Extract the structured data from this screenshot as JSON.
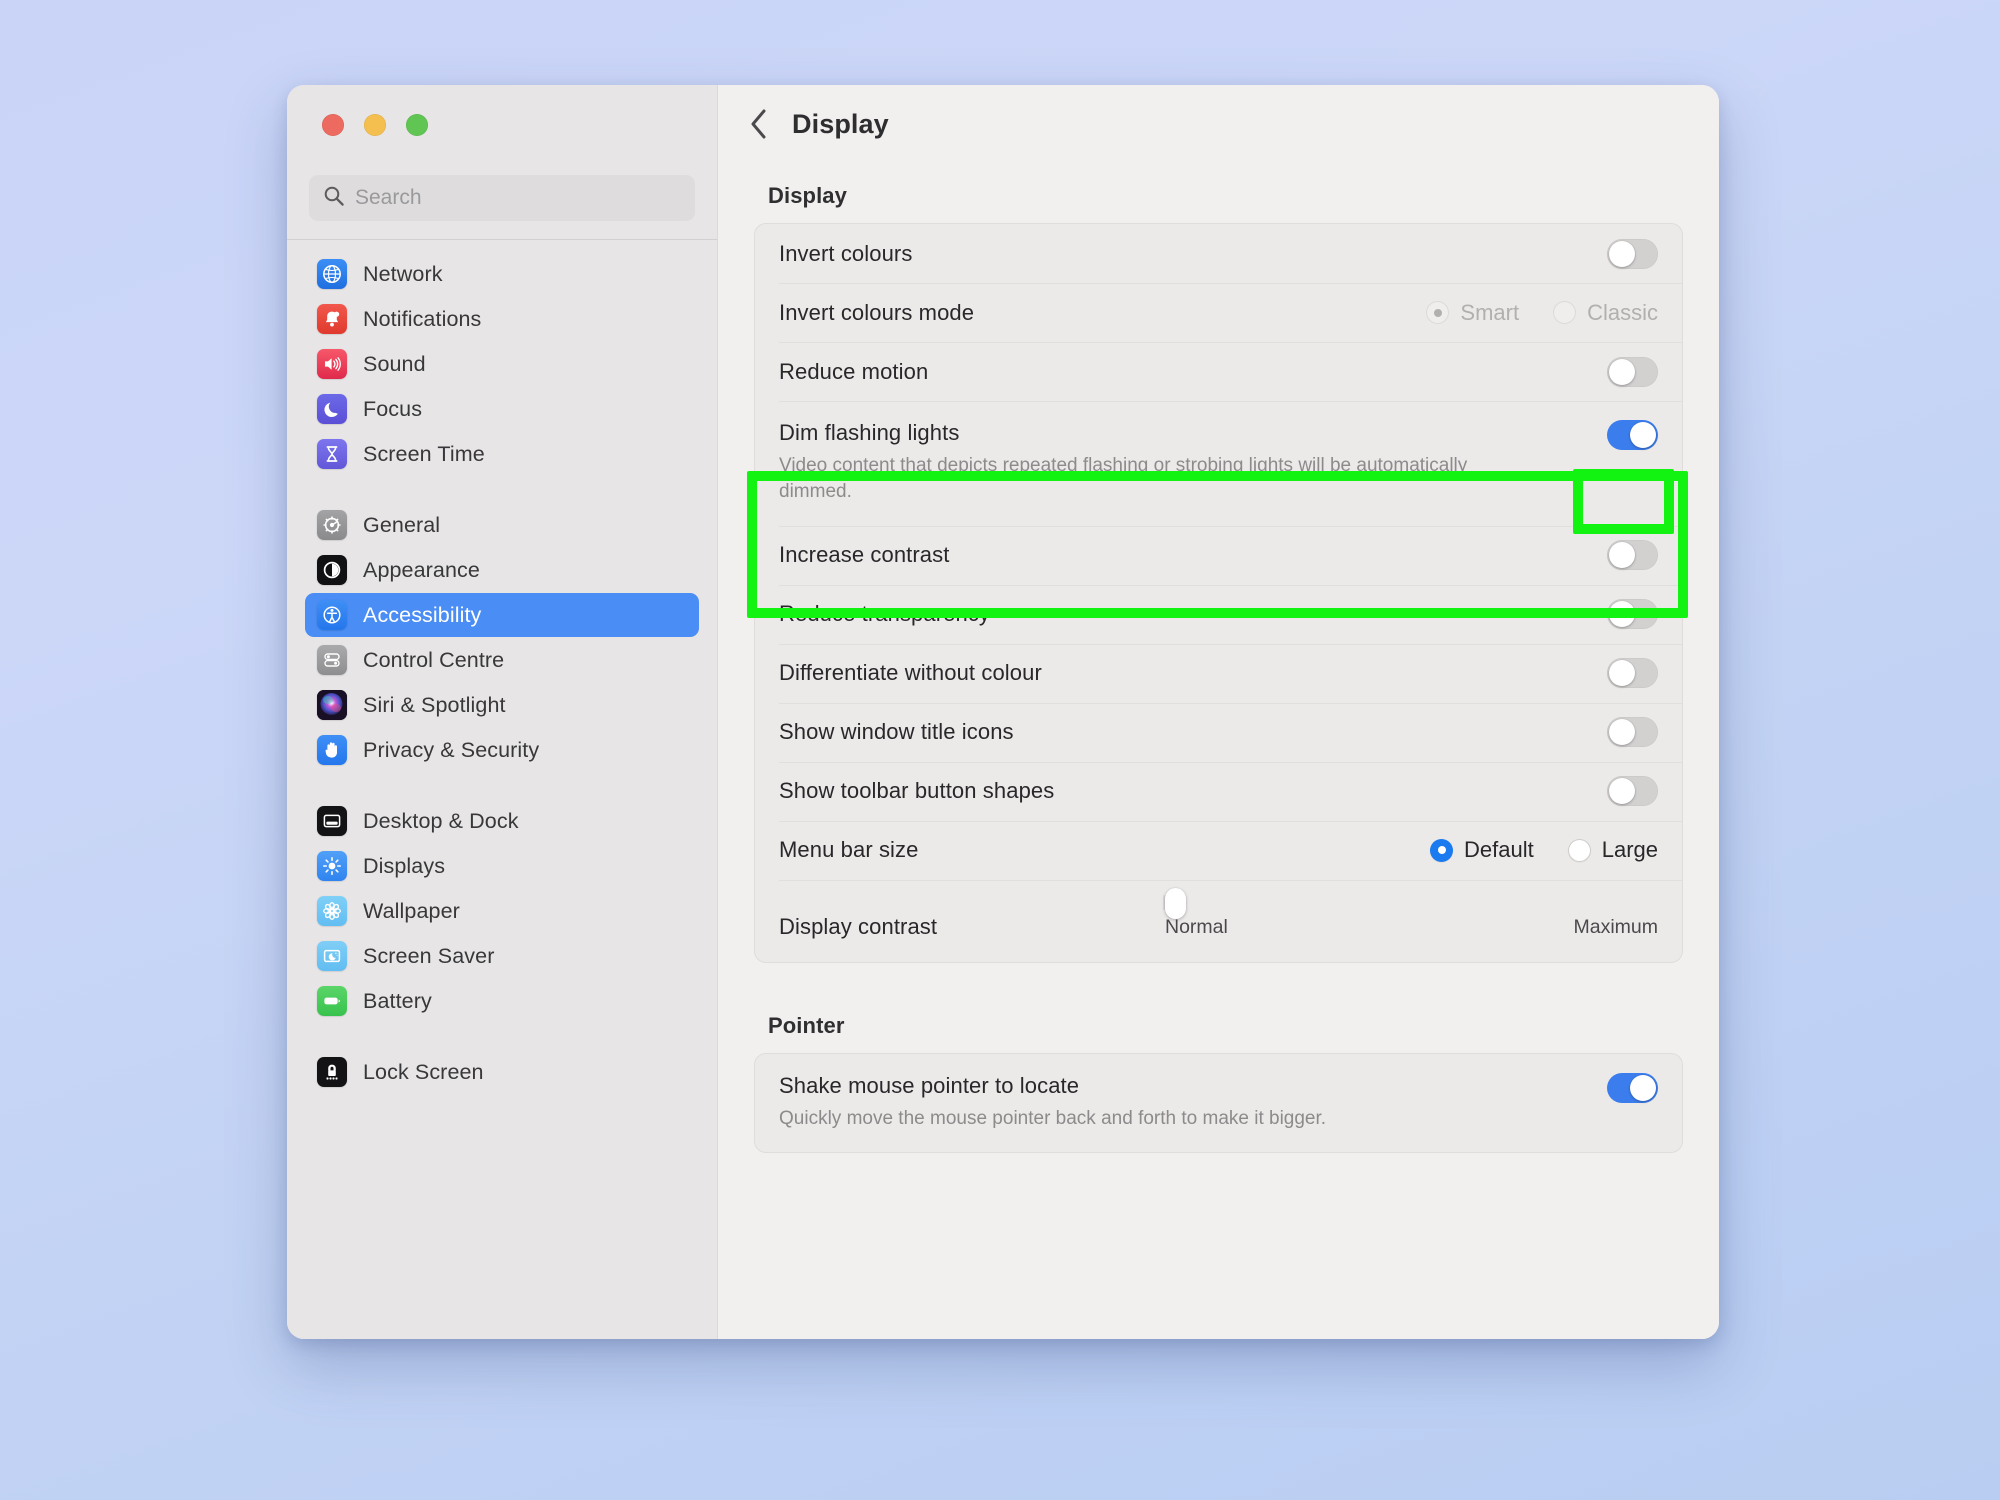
{
  "window": {
    "traffic_lights": [
      {
        "name": "close",
        "color": "#ec6a5f"
      },
      {
        "name": "minimize",
        "color": "#f4bf4f"
      },
      {
        "name": "zoom",
        "color": "#61c554"
      }
    ]
  },
  "sidebar": {
    "search": {
      "value": "",
      "placeholder": "Search"
    },
    "groups": [
      {
        "items": [
          {
            "label": "Network",
            "icon": "globe-icon",
            "selected": false
          },
          {
            "label": "Notifications",
            "icon": "bell-icon",
            "selected": false
          },
          {
            "label": "Sound",
            "icon": "speaker-icon",
            "selected": false
          },
          {
            "label": "Focus",
            "icon": "moon-icon",
            "selected": false
          },
          {
            "label": "Screen Time",
            "icon": "hourglass-icon",
            "selected": false
          }
        ]
      },
      {
        "items": [
          {
            "label": "General",
            "icon": "gear-icon",
            "selected": false
          },
          {
            "label": "Appearance",
            "icon": "appearance-icon",
            "selected": false
          },
          {
            "label": "Accessibility",
            "icon": "accessibility-icon",
            "selected": true
          },
          {
            "label": "Control Centre",
            "icon": "control-centre-icon",
            "selected": false
          },
          {
            "label": "Siri & Spotlight",
            "icon": "siri-icon",
            "selected": false
          },
          {
            "label": "Privacy & Security",
            "icon": "hand-icon",
            "selected": false
          }
        ]
      },
      {
        "items": [
          {
            "label": "Desktop & Dock",
            "icon": "desktop-dock-icon",
            "selected": false
          },
          {
            "label": "Displays",
            "icon": "brightness-icon",
            "selected": false
          },
          {
            "label": "Wallpaper",
            "icon": "wallpaper-icon",
            "selected": false
          },
          {
            "label": "Screen Saver",
            "icon": "screen-saver-icon",
            "selected": false
          },
          {
            "label": "Battery",
            "icon": "battery-icon",
            "selected": false
          }
        ]
      },
      {
        "items": [
          {
            "label": "Lock Screen",
            "icon": "lock-icon",
            "selected": false
          }
        ]
      }
    ]
  },
  "content": {
    "back_icon": "chevron-left-icon",
    "title": "Display",
    "sections": [
      {
        "heading": "Display",
        "rows": [
          {
            "label": "Invert colours",
            "control": "toggle",
            "value": "off"
          },
          {
            "label": "Invert colours mode",
            "control": "radio",
            "disabled": true,
            "options": [
              {
                "label": "Smart",
                "checked": true
              },
              {
                "label": "Classic",
                "checked": false
              }
            ]
          },
          {
            "label": "Reduce motion",
            "control": "toggle",
            "value": "off"
          },
          {
            "label": "Dim flashing lights",
            "sublabel": "Video content that depicts repeated flashing or strobing lights will be automatically dimmed.",
            "control": "toggle",
            "value": "on",
            "highlighted": true
          },
          {
            "label": "Increase contrast",
            "control": "toggle",
            "value": "off"
          },
          {
            "label": "Reduce transparency",
            "control": "toggle",
            "value": "off"
          },
          {
            "label": "Differentiate without colour",
            "control": "toggle",
            "value": "off"
          },
          {
            "label": "Show window title icons",
            "control": "toggle",
            "value": "off"
          },
          {
            "label": "Show toolbar button shapes",
            "control": "toggle",
            "value": "off"
          },
          {
            "label": "Menu bar size",
            "control": "radio",
            "disabled": false,
            "options": [
              {
                "label": "Default",
                "checked": true
              },
              {
                "label": "Large",
                "checked": false
              }
            ]
          },
          {
            "label": "Display contrast",
            "control": "slider",
            "min_label": "Normal",
            "max_label": "Maximum",
            "value_percent": 0,
            "tick_count": 5
          }
        ]
      },
      {
        "heading": "Pointer",
        "rows": [
          {
            "label": "Shake mouse pointer to locate",
            "sublabel": "Quickly move the mouse pointer back and forth to make it bigger.",
            "control": "toggle",
            "value": "on"
          }
        ]
      }
    ]
  },
  "annotation": {
    "highlight_color": "#12f312",
    "targets": [
      "dim-flashing-lights-row",
      "dim-flashing-lights-toggle"
    ]
  }
}
